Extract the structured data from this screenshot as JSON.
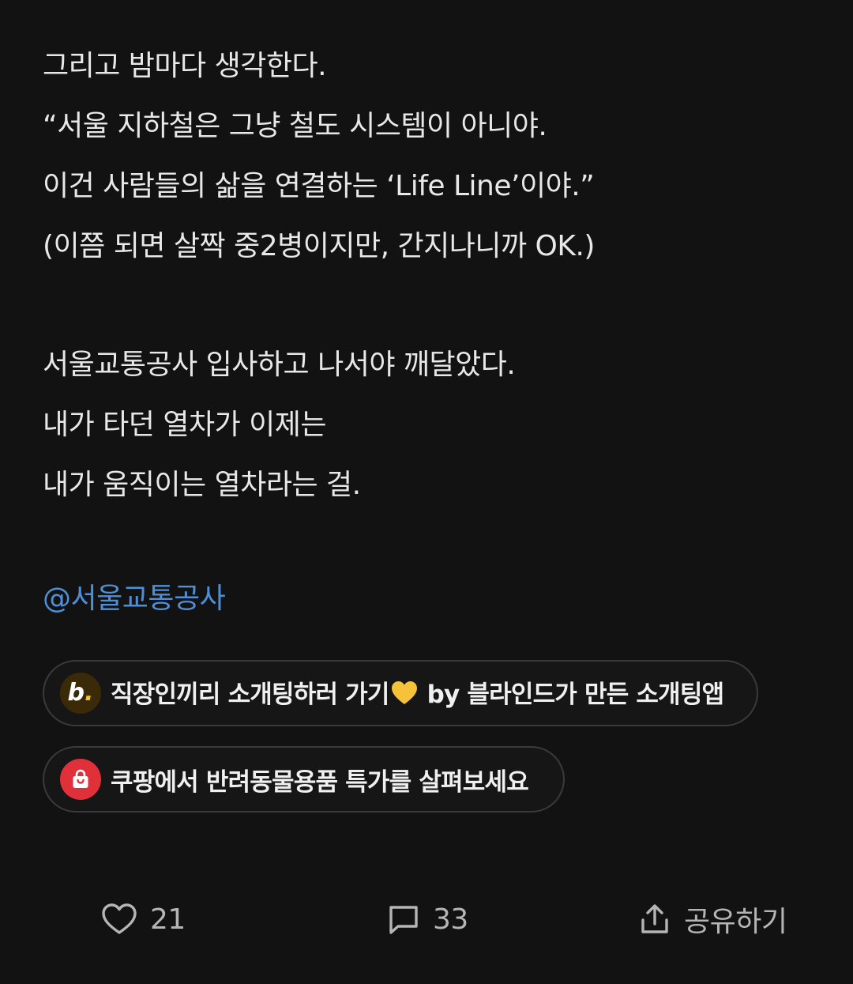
{
  "post": {
    "lines": [
      "그리고 밤마다 생각한다.",
      "“서울 지하철은 그냥 철도 시스템이 아니야.",
      "이건 사람들의 삶을 연결하는 ‘Life Line’이야.”",
      "(이쯤 되면 살짝 중2병이지만, 간지나니까 OK.)",
      "서울교통공사 입사하고 나서야 깨달았다.",
      "내가 타던 열차가 이제는",
      "내가 움직이는 열차라는 걸."
    ],
    "mention": "@서울교통공사"
  },
  "ads": [
    {
      "icon": "blind-logo-icon",
      "text_before": "직장인끼리 소개팅하러 가기",
      "text_after": " by 블라인드가 만든 소개팅앱"
    },
    {
      "icon": "shopping-bag-icon",
      "text": "쿠팡에서 반려동물용품 특가를 살펴보세요"
    }
  ],
  "actions": {
    "like_count": "21",
    "comment_count": "33",
    "share_label": "공유하기"
  },
  "colors": {
    "background": "#121212",
    "mention": "#4f8fd6",
    "coupang_red": "#e0303a"
  }
}
